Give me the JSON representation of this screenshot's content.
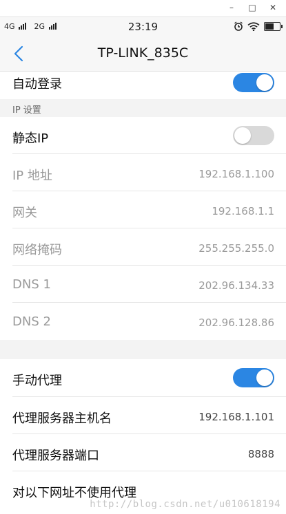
{
  "window": {
    "minimize": "–",
    "maximize": "□",
    "close": "✕"
  },
  "status_bar": {
    "net1": "4G",
    "net2": "2G",
    "time": "23:19"
  },
  "nav": {
    "title": "TP-LINK_835C"
  },
  "rows": {
    "auto_login": {
      "label": "自动登录",
      "toggle": "on"
    },
    "ip_section": "IP 设置",
    "static_ip": {
      "label": "静态IP",
      "toggle": "off"
    },
    "ip_address": {
      "label": "IP 地址",
      "value": "192.168.1.100"
    },
    "gateway": {
      "label": "网关",
      "value": "192.168.1.1"
    },
    "netmask": {
      "label": "网络掩码",
      "value": "255.255.255.0"
    },
    "dns1": {
      "label": "DNS 1",
      "value": "202.96.134.33"
    },
    "dns2": {
      "label": "DNS 2",
      "value": "202.96.128.86"
    },
    "manual_proxy": {
      "label": "手动代理",
      "toggle": "on"
    },
    "proxy_host": {
      "label": "代理服务器主机名",
      "value": "192.168.1.101"
    },
    "proxy_port": {
      "label": "代理服务器端口",
      "value": "8888"
    },
    "bypass": {
      "label": "对以下网址不使用代理"
    }
  },
  "watermark": "http://blog.csdn.net/u010618194",
  "colors": {
    "accent": "#2b86e3",
    "toggle_off": "#d9d9d9",
    "dim_text": "#9a9a9a"
  }
}
